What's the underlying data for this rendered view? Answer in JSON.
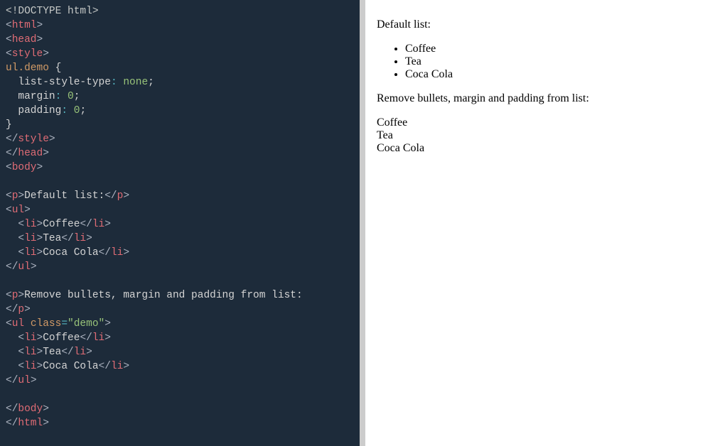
{
  "code": {
    "doctype": "<!DOCTYPE html>",
    "tag_html_open": "html",
    "tag_head_open": "head",
    "tag_style_open": "style",
    "css_selector": "ul",
    "css_class_dot": ".demo",
    "css_brace_open": " {",
    "css_prop_1": "  list-style-type",
    "css_val_1": " none",
    "css_prop_2": "  margin",
    "css_val_2": " 0",
    "css_prop_3": "  padding",
    "css_val_3": " 0",
    "css_brace_close": "}",
    "tag_style_close": "style",
    "tag_head_close": "head",
    "tag_body_open": "body",
    "tag_p": "p",
    "p1_text": "Default list:",
    "tag_ul": "ul",
    "tag_li": "li",
    "li_1": "Coffee",
    "li_2": "Tea",
    "li_3": "Coca Cola",
    "p2_text": "Remove bullets, margin and padding from list:",
    "ul_attr_name": "class",
    "ul_attr_val": "\"demo\"",
    "tag_body_close": "body",
    "tag_html_close": "html"
  },
  "preview": {
    "heading1": "Default list:",
    "list1": {
      "item1": "Coffee",
      "item2": "Tea",
      "item3": "Coca Cola"
    },
    "heading2": "Remove bullets, margin and padding from list:",
    "list2": {
      "item1": "Coffee",
      "item2": "Tea",
      "item3": "Coca Cola"
    }
  }
}
